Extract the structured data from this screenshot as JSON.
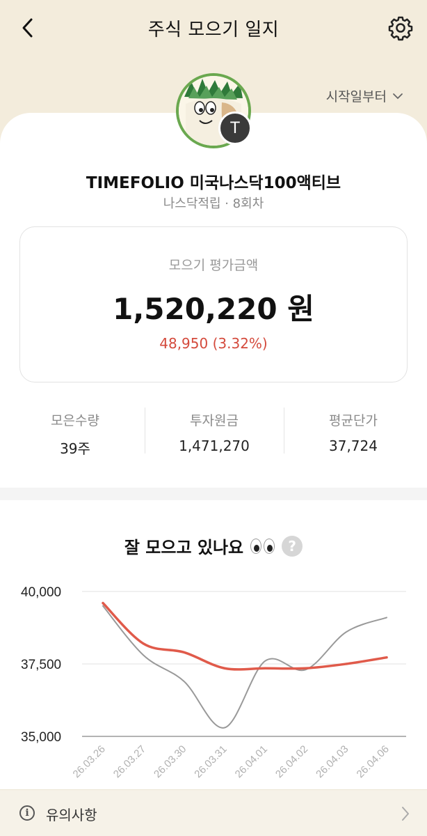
{
  "header": {
    "title": "주식 모으기 일지",
    "back_icon": "chevron-left-icon",
    "settings_icon": "gear-icon"
  },
  "start_select": {
    "label": "시작일부터",
    "icon": "chevron-down-icon"
  },
  "avatar": {
    "badge_letter": "T",
    "ring_color": "#6aa84f"
  },
  "fund": {
    "name": "TIMEFOLIO 미국나스닥100액티브",
    "subtitle": "나스닥적립 · 8회차"
  },
  "valuation": {
    "label": "모으기 평가금액",
    "amount": "1,520,220 원",
    "change": "48,950 (3.32%)",
    "change_color": "#d44a3c"
  },
  "stats": [
    {
      "label": "모은수량",
      "value": "39주"
    },
    {
      "label": "투자원금",
      "value": "1,471,270"
    },
    {
      "label": "평균단가",
      "value": "37,724"
    }
  ],
  "chart_section": {
    "title": "잘 모으고 있나요",
    "help_icon": "question-icon",
    "help_glyph": "?"
  },
  "chart_data": {
    "type": "line",
    "categories": [
      "26.03.26",
      "26.03.27",
      "26.03.30",
      "26.03.31",
      "26.04.01",
      "26.04.02",
      "26.04.03",
      "26.04.06"
    ],
    "yticks": [
      "40,000",
      "37,500",
      "35,000"
    ],
    "ylim": [
      35000,
      40000
    ],
    "series": [
      {
        "color": "#e05a4a",
        "values": [
          39600,
          38200,
          37900,
          37350,
          37350,
          37350,
          37500,
          37724
        ]
      },
      {
        "color": "#999999",
        "values": [
          39500,
          37800,
          36900,
          35300,
          37600,
          37300,
          38600,
          39100
        ]
      }
    ],
    "grid": true
  },
  "footer": {
    "label": "유의사항",
    "info_icon": "info-icon",
    "info_glyph": "i",
    "chevron_icon": "chevron-right-icon"
  }
}
